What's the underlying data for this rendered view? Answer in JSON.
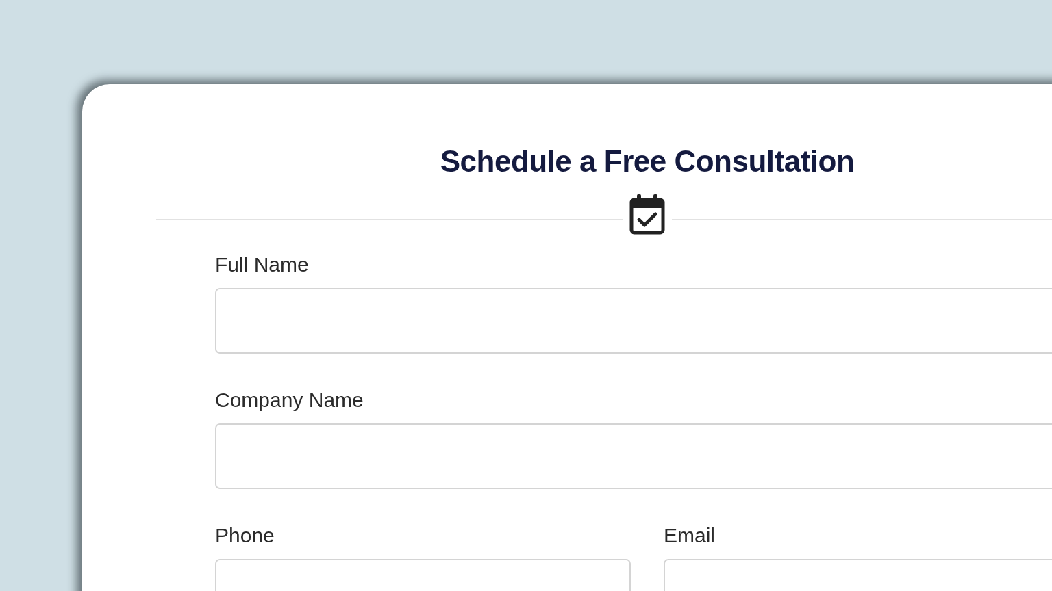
{
  "form": {
    "title": "Schedule a Free Consultation",
    "rows": [
      {
        "fields": [
          {
            "label": "Full Name"
          }
        ]
      },
      {
        "fields": [
          {
            "label": "Company Name"
          }
        ]
      },
      {
        "fields": [
          {
            "label": "Phone"
          },
          {
            "label": "Email"
          }
        ]
      }
    ]
  }
}
